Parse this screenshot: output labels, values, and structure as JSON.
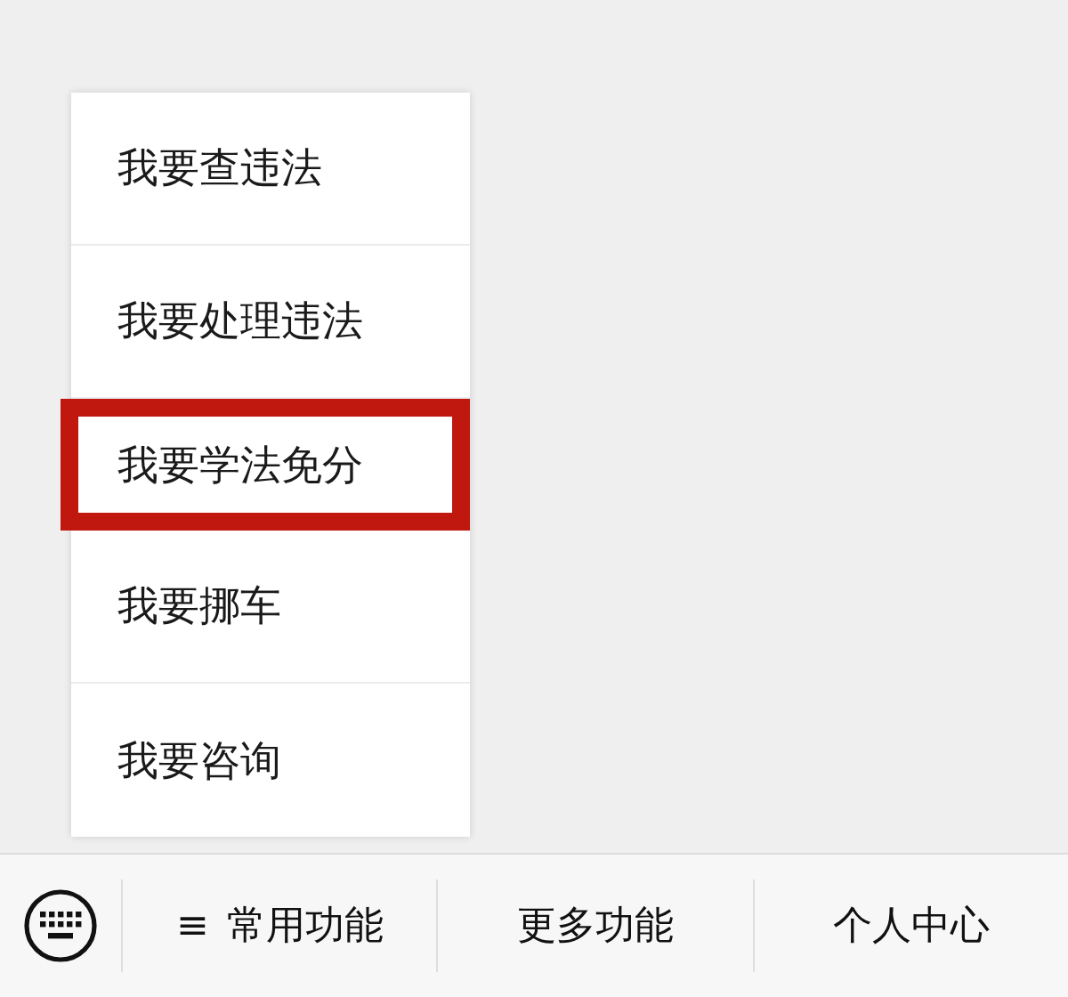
{
  "menu": {
    "items": [
      {
        "label": "我要查违法",
        "highlighted": false
      },
      {
        "label": "我要处理违法",
        "highlighted": false
      },
      {
        "label": "我要学法免分",
        "highlighted": true
      },
      {
        "label": "我要挪车",
        "highlighted": false
      },
      {
        "label": "我要咨询",
        "highlighted": false
      }
    ]
  },
  "bottom_bar": {
    "tabs": [
      {
        "symbol": "≡",
        "label": "常用功能"
      },
      {
        "label": "更多功能"
      },
      {
        "label": "个人中心"
      }
    ]
  }
}
